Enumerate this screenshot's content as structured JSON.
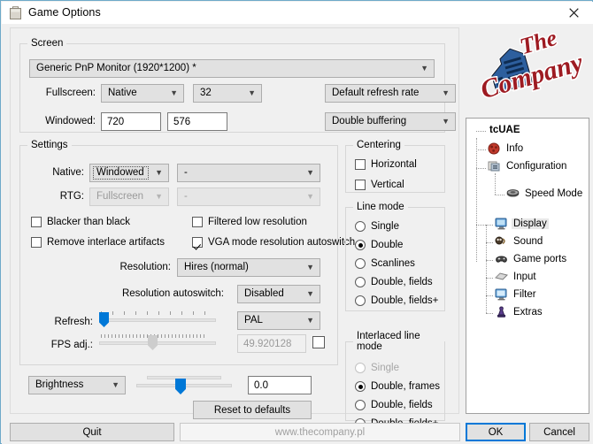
{
  "window": {
    "title": "Game Options",
    "title_icon": "app-icon",
    "close_label": "✕"
  },
  "screen_group": {
    "legend": "Screen",
    "monitor_value": "Generic PnP Monitor (1920*1200) *",
    "fullscreen_label": "Fullscreen:",
    "fullscreen_mode": "Native",
    "fullscreen_depth": "32",
    "refresh_rate": "Default refresh rate",
    "windowed_label": "Windowed:",
    "windowed_width": "720",
    "windowed_height": "576",
    "buffering": "Double buffering"
  },
  "settings_group": {
    "legend": "Settings",
    "native_label": "Native:",
    "native_value": "Windowed",
    "native_extra": "-",
    "rtg_label": "RTG:",
    "rtg_value": "Fullscreen",
    "rtg_extra": "-",
    "checkboxes": [
      {
        "label": "Blacker than black",
        "checked": false
      },
      {
        "label": "Remove interlace artifacts",
        "checked": false
      },
      {
        "label": "Filtered low resolution",
        "checked": false
      },
      {
        "label": "VGA mode resolution autoswitch",
        "checked": true
      }
    ],
    "resolution_label": "Resolution:",
    "resolution_value": "Hires (normal)",
    "res_autoswitch_label": "Resolution autoswitch:",
    "res_autoswitch_value": "Disabled",
    "refresh_label": "Refresh:",
    "refresh_mode": "PAL",
    "fps_label": "FPS adj.:",
    "fps_value": "49.920128",
    "fps_checked": false
  },
  "bottom_controls": {
    "adjust_select": "Brightness",
    "adjust_value": "0.0",
    "reset_label": "Reset to defaults"
  },
  "centering_group": {
    "legend": "Centering",
    "items": [
      {
        "label": "Horizontal",
        "checked": false
      },
      {
        "label": "Vertical",
        "checked": false
      }
    ]
  },
  "line_mode_group": {
    "legend": "Line mode",
    "items": [
      {
        "label": "Single",
        "selected": false,
        "disabled": false
      },
      {
        "label": "Double",
        "selected": true,
        "disabled": false
      },
      {
        "label": "Scanlines",
        "selected": false,
        "disabled": false
      },
      {
        "label": "Double, fields",
        "selected": false,
        "disabled": false
      },
      {
        "label": "Double, fields+",
        "selected": false,
        "disabled": false
      }
    ]
  },
  "interlaced_group": {
    "legend": "Interlaced line mode",
    "items": [
      {
        "label": "Single",
        "selected": false,
        "disabled": true
      },
      {
        "label": "Double, frames",
        "selected": true,
        "disabled": false
      },
      {
        "label": "Double, fields",
        "selected": false,
        "disabled": false
      },
      {
        "label": "Double, fields+",
        "selected": false,
        "disabled": false
      }
    ]
  },
  "logo": {
    "line1": "The",
    "line2": "Company"
  },
  "tree": {
    "nodes": [
      {
        "label": "tcUAE",
        "icon": "root-icon",
        "selected": false
      },
      {
        "label": "Info",
        "icon": "info-icon",
        "selected": false
      },
      {
        "label": "Configuration",
        "icon": "configuration-icon",
        "selected": false
      },
      {
        "label": "Speed Mode",
        "icon": "speed-mode-icon",
        "selected": false
      },
      {
        "label": "Display",
        "icon": "display-icon",
        "selected": true
      },
      {
        "label": "Sound",
        "icon": "sound-icon",
        "selected": false
      },
      {
        "label": "Game ports",
        "icon": "gameports-icon",
        "selected": false
      },
      {
        "label": "Input",
        "icon": "input-icon",
        "selected": false
      },
      {
        "label": "Filter",
        "icon": "filter-icon",
        "selected": false
      },
      {
        "label": "Extras",
        "icon": "extras-icon",
        "selected": false
      }
    ]
  },
  "footer": {
    "quit": "Quit",
    "url": "www.thecompany.pl",
    "ok": "OK",
    "cancel": "Cancel"
  },
  "colors": {
    "accent": "#0078d7",
    "window_border": "#6ea9c9",
    "face": "#f0f0f0"
  }
}
